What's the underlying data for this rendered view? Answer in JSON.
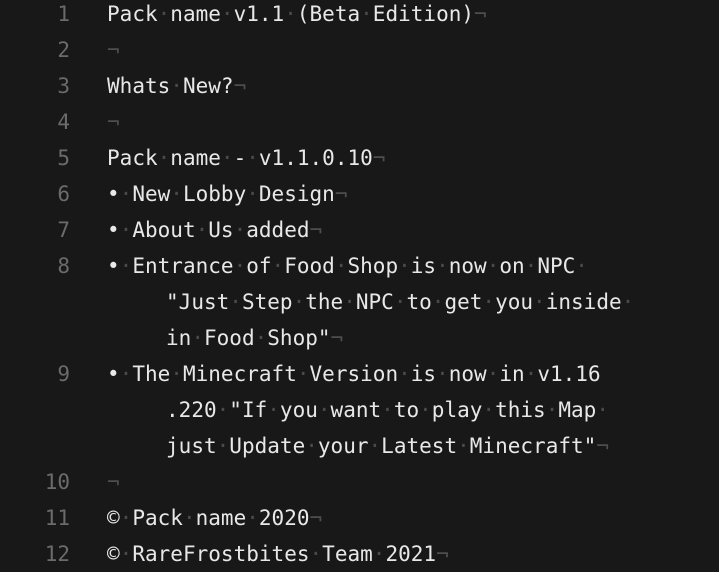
{
  "editor": {
    "lines": [
      {
        "num": "1",
        "rows": [
          "Pack name v1.1 (Beta Edition)"
        ]
      },
      {
        "num": "2",
        "rows": [
          ""
        ]
      },
      {
        "num": "3",
        "rows": [
          "Whats New?"
        ]
      },
      {
        "num": "4",
        "rows": [
          ""
        ]
      },
      {
        "num": "5",
        "rows": [
          "Pack name - v1.1.0.10"
        ]
      },
      {
        "num": "6",
        "rows": [
          "• New Lobby Design"
        ]
      },
      {
        "num": "7",
        "rows": [
          "• About Us added"
        ]
      },
      {
        "num": "8",
        "rows": [
          "• Entrance of Food Shop is now on NPC ",
          "\"Just Step the NPC to get you inside ",
          "in Food Shop\""
        ]
      },
      {
        "num": "9",
        "rows": [
          "• The Minecraft Version is now in v1.16",
          ".220 \"If you want to play this Map ",
          "just Update your Latest Minecraft\""
        ]
      },
      {
        "num": "10",
        "rows": [
          ""
        ]
      },
      {
        "num": "11",
        "rows": [
          "© Pack name 2020"
        ]
      },
      {
        "num": "12",
        "rows": [
          "© RareFrostbites Team 2021"
        ]
      }
    ],
    "eol_marker": "¬",
    "space_marker": "·"
  },
  "colors": {
    "background": "#181818",
    "text": "#e8e8e8",
    "gutter": "#6b6b6b",
    "whitespace_marker": "#4a4a4a"
  }
}
